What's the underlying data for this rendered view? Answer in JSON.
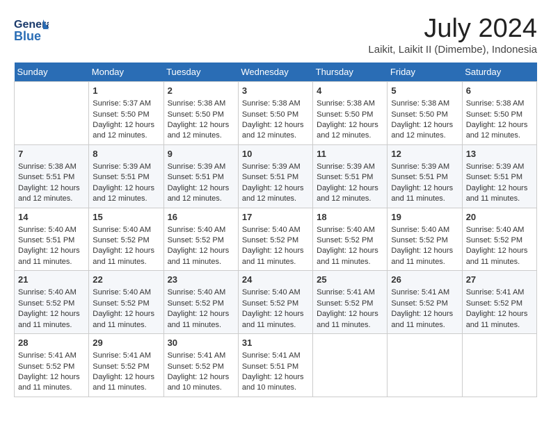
{
  "header": {
    "logo_general": "General",
    "logo_blue": "Blue",
    "title": "July 2024",
    "subtitle": "Laikit, Laikit II (Dimembe), Indonesia"
  },
  "columns": [
    "Sunday",
    "Monday",
    "Tuesday",
    "Wednesday",
    "Thursday",
    "Friday",
    "Saturday"
  ],
  "weeks": [
    {
      "cells": [
        {
          "day": "",
          "data": ""
        },
        {
          "day": "1",
          "data": "Sunrise: 5:37 AM\nSunset: 5:50 PM\nDaylight: 12 hours\nand 12 minutes."
        },
        {
          "day": "2",
          "data": "Sunrise: 5:38 AM\nSunset: 5:50 PM\nDaylight: 12 hours\nand 12 minutes."
        },
        {
          "day": "3",
          "data": "Sunrise: 5:38 AM\nSunset: 5:50 PM\nDaylight: 12 hours\nand 12 minutes."
        },
        {
          "day": "4",
          "data": "Sunrise: 5:38 AM\nSunset: 5:50 PM\nDaylight: 12 hours\nand 12 minutes."
        },
        {
          "day": "5",
          "data": "Sunrise: 5:38 AM\nSunset: 5:50 PM\nDaylight: 12 hours\nand 12 minutes."
        },
        {
          "day": "6",
          "data": "Sunrise: 5:38 AM\nSunset: 5:50 PM\nDaylight: 12 hours\nand 12 minutes."
        }
      ]
    },
    {
      "cells": [
        {
          "day": "7",
          "data": "Sunrise: 5:38 AM\nSunset: 5:51 PM\nDaylight: 12 hours\nand 12 minutes."
        },
        {
          "day": "8",
          "data": "Sunrise: 5:39 AM\nSunset: 5:51 PM\nDaylight: 12 hours\nand 12 minutes."
        },
        {
          "day": "9",
          "data": "Sunrise: 5:39 AM\nSunset: 5:51 PM\nDaylight: 12 hours\nand 12 minutes."
        },
        {
          "day": "10",
          "data": "Sunrise: 5:39 AM\nSunset: 5:51 PM\nDaylight: 12 hours\nand 12 minutes."
        },
        {
          "day": "11",
          "data": "Sunrise: 5:39 AM\nSunset: 5:51 PM\nDaylight: 12 hours\nand 12 minutes."
        },
        {
          "day": "12",
          "data": "Sunrise: 5:39 AM\nSunset: 5:51 PM\nDaylight: 12 hours\nand 11 minutes."
        },
        {
          "day": "13",
          "data": "Sunrise: 5:39 AM\nSunset: 5:51 PM\nDaylight: 12 hours\nand 11 minutes."
        }
      ]
    },
    {
      "cells": [
        {
          "day": "14",
          "data": "Sunrise: 5:40 AM\nSunset: 5:51 PM\nDaylight: 12 hours\nand 11 minutes."
        },
        {
          "day": "15",
          "data": "Sunrise: 5:40 AM\nSunset: 5:52 PM\nDaylight: 12 hours\nand 11 minutes."
        },
        {
          "day": "16",
          "data": "Sunrise: 5:40 AM\nSunset: 5:52 PM\nDaylight: 12 hours\nand 11 minutes."
        },
        {
          "day": "17",
          "data": "Sunrise: 5:40 AM\nSunset: 5:52 PM\nDaylight: 12 hours\nand 11 minutes."
        },
        {
          "day": "18",
          "data": "Sunrise: 5:40 AM\nSunset: 5:52 PM\nDaylight: 12 hours\nand 11 minutes."
        },
        {
          "day": "19",
          "data": "Sunrise: 5:40 AM\nSunset: 5:52 PM\nDaylight: 12 hours\nand 11 minutes."
        },
        {
          "day": "20",
          "data": "Sunrise: 5:40 AM\nSunset: 5:52 PM\nDaylight: 12 hours\nand 11 minutes."
        }
      ]
    },
    {
      "cells": [
        {
          "day": "21",
          "data": "Sunrise: 5:40 AM\nSunset: 5:52 PM\nDaylight: 12 hours\nand 11 minutes."
        },
        {
          "day": "22",
          "data": "Sunrise: 5:40 AM\nSunset: 5:52 PM\nDaylight: 12 hours\nand 11 minutes."
        },
        {
          "day": "23",
          "data": "Sunrise: 5:40 AM\nSunset: 5:52 PM\nDaylight: 12 hours\nand 11 minutes."
        },
        {
          "day": "24",
          "data": "Sunrise: 5:40 AM\nSunset: 5:52 PM\nDaylight: 12 hours\nand 11 minutes."
        },
        {
          "day": "25",
          "data": "Sunrise: 5:41 AM\nSunset: 5:52 PM\nDaylight: 12 hours\nand 11 minutes."
        },
        {
          "day": "26",
          "data": "Sunrise: 5:41 AM\nSunset: 5:52 PM\nDaylight: 12 hours\nand 11 minutes."
        },
        {
          "day": "27",
          "data": "Sunrise: 5:41 AM\nSunset: 5:52 PM\nDaylight: 12 hours\nand 11 minutes."
        }
      ]
    },
    {
      "cells": [
        {
          "day": "28",
          "data": "Sunrise: 5:41 AM\nSunset: 5:52 PM\nDaylight: 12 hours\nand 11 minutes."
        },
        {
          "day": "29",
          "data": "Sunrise: 5:41 AM\nSunset: 5:52 PM\nDaylight: 12 hours\nand 11 minutes."
        },
        {
          "day": "30",
          "data": "Sunrise: 5:41 AM\nSunset: 5:52 PM\nDaylight: 12 hours\nand 10 minutes."
        },
        {
          "day": "31",
          "data": "Sunrise: 5:41 AM\nSunset: 5:51 PM\nDaylight: 12 hours\nand 10 minutes."
        },
        {
          "day": "",
          "data": ""
        },
        {
          "day": "",
          "data": ""
        },
        {
          "day": "",
          "data": ""
        }
      ]
    }
  ]
}
